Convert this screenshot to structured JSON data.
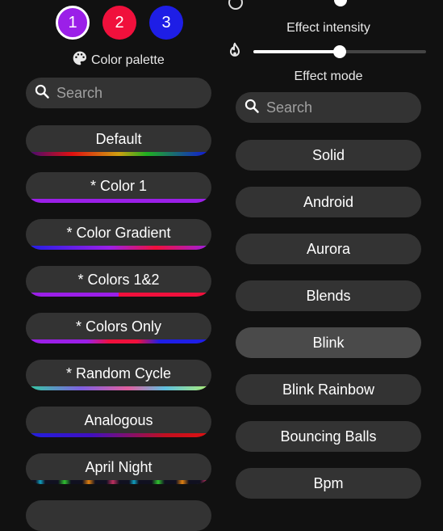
{
  "color_slots": [
    {
      "label": "1",
      "color": "#9b1fe8",
      "active": true
    },
    {
      "label": "2",
      "color": "#f0103c",
      "active": false
    },
    {
      "label": "3",
      "color": "#1e1ee6",
      "active": false
    }
  ],
  "palette": {
    "title": "Color palette",
    "icon": "palette-icon",
    "search_placeholder": "Search",
    "items": [
      {
        "label": "Default",
        "gradient": "linear-gradient(90deg,#3a0a7a 0%,#e01010 25%,#d0a010 50%,#20b020 65%,#1010e0 100%)"
      },
      {
        "label": "* Color 1",
        "gradient": "linear-gradient(90deg,#9b1fe8,#9b1fe8)"
      },
      {
        "label": "* Color Gradient",
        "gradient": "linear-gradient(90deg,#1e1ee6 0%,#9b1fe8 45%,#f0103c 70%,#9b1fe8 100%)"
      },
      {
        "label": "* Colors 1&2",
        "gradient": "linear-gradient(90deg,#9b1fe8 0%,#9b1fe8 50%,#f0103c 50%,#f0103c 100%)"
      },
      {
        "label": "* Colors Only",
        "gradient": "linear-gradient(90deg,#9b1fe8 0%,#9b1fe8 33%,#f0103c 45%,#f0103c 60%,#1e1ee6 72%,#1e1ee6 100%)"
      },
      {
        "label": "* Random Cycle",
        "gradient": "linear-gradient(90deg,#30d0a0 0%,#8060e0 30%,#e060a0 55%,#60c0e0 75%,#b0f070 100%)"
      },
      {
        "label": "Analogous",
        "gradient": "linear-gradient(90deg,#2020e0 0%,#4010c0 35%,#c01020 75%,#e01010 100%)"
      },
      {
        "label": "April Night",
        "gradient": "repeating-linear-gradient(90deg,#101020 0px,#101020 12px,#10a0c0 18px,#101020 24px,#101020 40px,#30c030 48px,#101020 56px,#101020 70px,#e08010 78px,#101020 86px,#101020 100px,#c03060 108px,#101020 116px)"
      }
    ]
  },
  "effect": {
    "intensity_label": "Effect intensity",
    "intensity_value": 0.5,
    "mode_label": "Effect mode",
    "search_placeholder": "Search",
    "items": [
      {
        "label": "Solid",
        "selected": false
      },
      {
        "label": "Android",
        "selected": false
      },
      {
        "label": "Aurora",
        "selected": false
      },
      {
        "label": "Blends",
        "selected": false
      },
      {
        "label": "Blink",
        "selected": true
      },
      {
        "label": "Blink Rainbow",
        "selected": false
      },
      {
        "label": "Bouncing Balls",
        "selected": false
      },
      {
        "label": "Bpm",
        "selected": false
      }
    ]
  }
}
